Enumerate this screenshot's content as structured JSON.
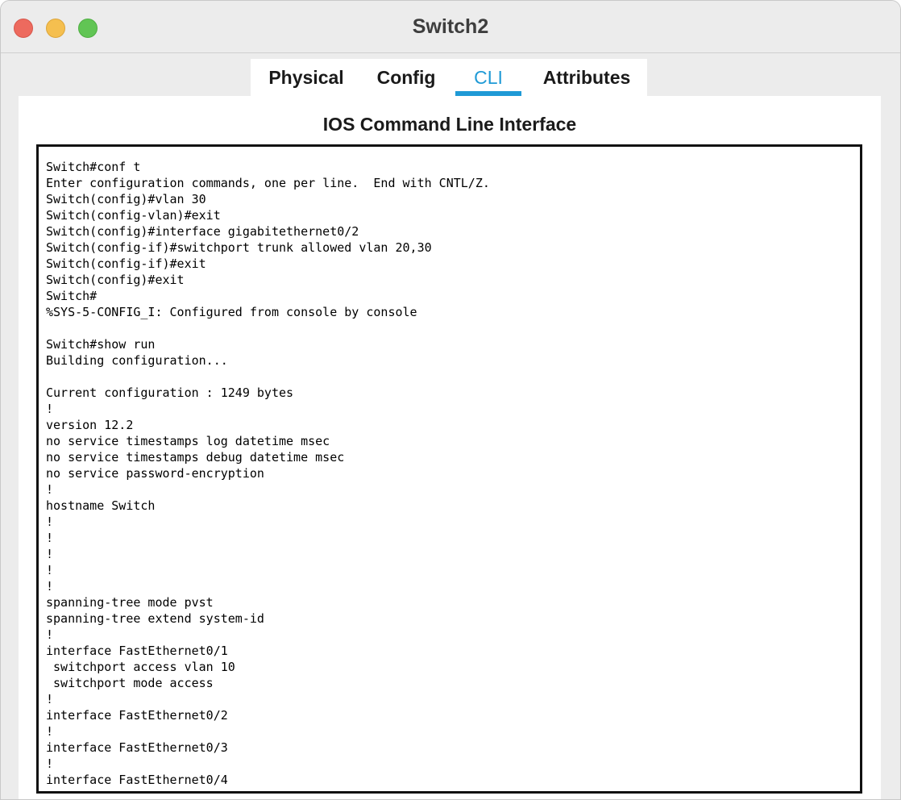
{
  "window": {
    "title": "Switch2"
  },
  "tabs": [
    {
      "label": "Physical",
      "active": false
    },
    {
      "label": "Config",
      "active": false
    },
    {
      "label": "CLI",
      "active": true
    },
    {
      "label": "Attributes",
      "active": false
    }
  ],
  "panel": {
    "title": "IOS Command Line Interface"
  },
  "colors": {
    "accent": "#1f9ad6",
    "close": "#ed6a5e",
    "minimize": "#f5bf4f",
    "maximize": "#61c554"
  },
  "cli": {
    "lines": [
      "Switch#conf t",
      "Enter configuration commands, one per line.  End with CNTL/Z.",
      "Switch(config)#vlan 30",
      "Switch(config-vlan)#exit",
      "Switch(config)#interface gigabitethernet0/2",
      "Switch(config-if)#switchport trunk allowed vlan 20,30",
      "Switch(config-if)#exit",
      "Switch(config)#exit",
      "Switch#",
      "%SYS-5-CONFIG_I: Configured from console by console",
      "",
      "Switch#show run",
      "Building configuration...",
      "",
      "Current configuration : 1249 bytes",
      "!",
      "version 12.2",
      "no service timestamps log datetime msec",
      "no service timestamps debug datetime msec",
      "no service password-encryption",
      "!",
      "hostname Switch",
      "!",
      "!",
      "!",
      "!",
      "!",
      "spanning-tree mode pvst",
      "spanning-tree extend system-id",
      "!",
      "interface FastEthernet0/1",
      " switchport access vlan 10",
      " switchport mode access",
      "!",
      "interface FastEthernet0/2",
      "!",
      "interface FastEthernet0/3",
      "!",
      "interface FastEthernet0/4",
      "!"
    ]
  }
}
